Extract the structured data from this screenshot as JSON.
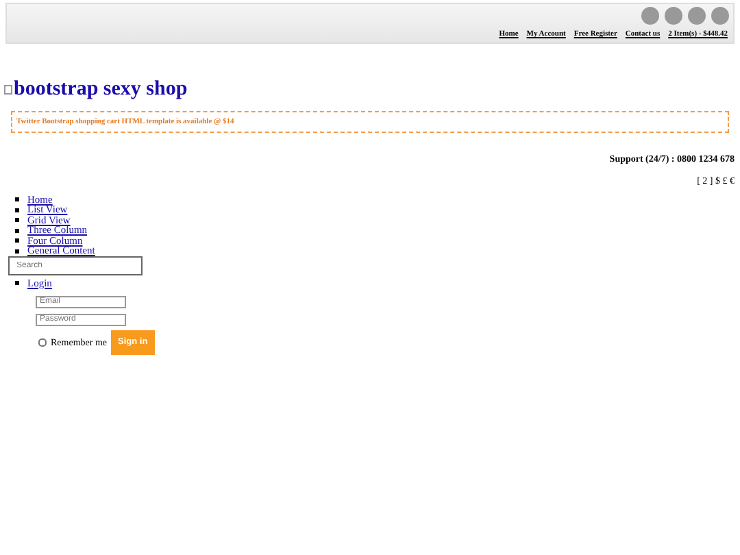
{
  "top_bar": {
    "social_icons": [
      {
        "kind": "circle"
      },
      {
        "kind": "circle"
      },
      {
        "kind": "circle"
      },
      {
        "kind": "circle"
      }
    ],
    "links": [
      "Home",
      "My Account",
      "Free Register",
      "Contact us",
      "2 Item(s) - $448.42"
    ]
  },
  "logo": {
    "alt": "bootstrap sexy shop"
  },
  "notice": "Twitter Bootstrap shopping cart HTML template is available @ $14",
  "support": "Support (24/7) : 0800 1234 678",
  "currency": "[ 2 ] $ £ €",
  "nav": [
    "Home",
    "List View",
    "Grid View",
    "Three Column",
    "Four Column",
    "General Content"
  ],
  "search": {
    "placeholder": "Search"
  },
  "login": {
    "link": "Login",
    "email_placeholder": "Email",
    "password_placeholder": "Password",
    "remember": "Remember me",
    "remember_checked": false,
    "button": "Sign in"
  }
}
